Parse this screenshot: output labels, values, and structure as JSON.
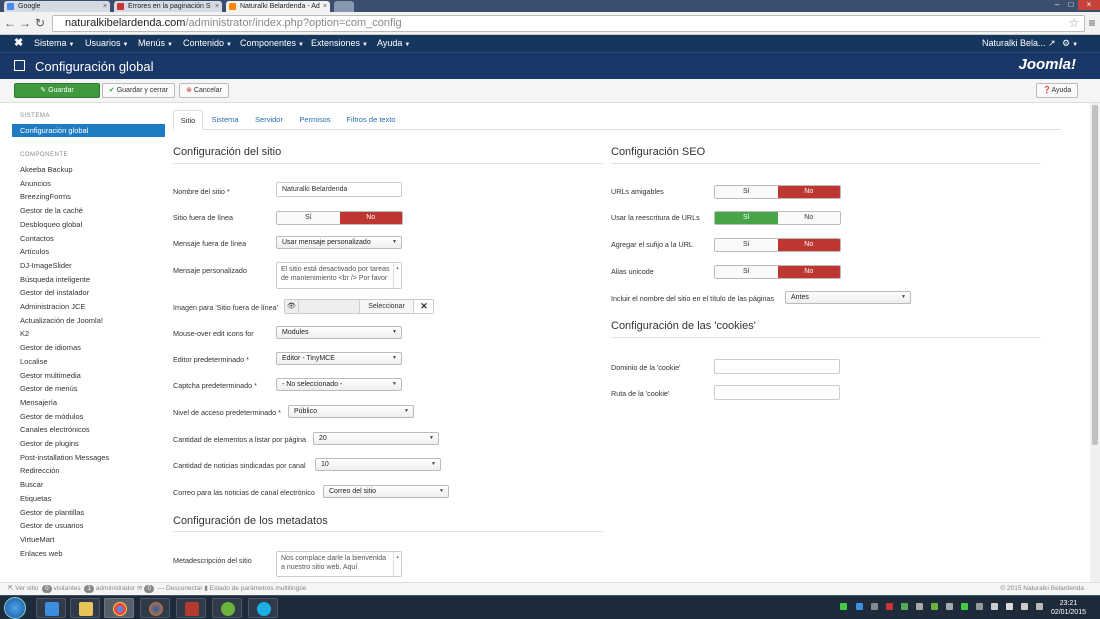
{
  "browser": {
    "tabs": [
      {
        "label": "Google"
      },
      {
        "label": "Errores en la paginación S"
      },
      {
        "label": "Naturalki Belardenda - Ad"
      }
    ],
    "url_host": "naturalkibelardenda.com",
    "url_path": "/administrator/index.php?option=com_config"
  },
  "navbar": {
    "menus": [
      "Sistema",
      "Usuarios",
      "Menús",
      "Contenido",
      "Componentes",
      "Extensiones",
      "Ayuda"
    ],
    "site_name": "Naturalki Bela..."
  },
  "header": {
    "title": "Configuración global",
    "logo": "Joomla!"
  },
  "toolbar": {
    "save": "Guardar",
    "save_close": "Guardar y cerrar",
    "cancel": "Cancelar",
    "help": "Ayuda"
  },
  "sidebar": {
    "system_heading": "SISTEMA",
    "active": "Configuración global",
    "component_heading": "COMPONENTE",
    "items": [
      "Akeeba Backup",
      "Anuncios",
      "BreezingForms",
      "Gestor de la caché",
      "Desbloqueo global",
      "Contactos",
      "Artículos",
      "DJ-ImageSlider",
      "Búsqueda inteligente",
      "Gestor del instalador",
      "Administracion JCE",
      "Actualización de Joomla!",
      "K2",
      "Gestor de idiomas",
      "Localise",
      "Gestor multimedia",
      "Gestor de menús",
      "Mensajería",
      "Gestor de módulos",
      "Canales electrónicos",
      "Gestor de plugins",
      "Post-installation Messages",
      "Redirección",
      "Buscar",
      "Etiquetas",
      "Gestor de plantillas",
      "Gestor de usuarios",
      "VirtueMart",
      "Enlaces web"
    ]
  },
  "tabs": [
    "Sitio",
    "Sistema",
    "Servidor",
    "Permisos",
    "Filtros de texto"
  ],
  "site": {
    "heading": "Configuración del sitio",
    "site_name_label": "Nombre del sitio *",
    "site_name_value": "Naturalki Belardenda",
    "offline_label": "Sitio fuera de línea",
    "offline_msg_label": "Mensaje fuera de línea",
    "offline_msg_value": "Usar mensaje personalizado",
    "custom_msg_label": "Mensaje personalizado",
    "custom_msg_value": "El sitio está desactivado por tareas de mantenimiento <br /> Por favor",
    "offline_image_label": "Imagen para 'Sitio fuera de línea'",
    "select_label": "Seleccionar",
    "mouseover_label": "Mouse-over edit icons for",
    "mouseover_value": "Modules",
    "editor_label": "Editor predeterminado *",
    "editor_value": "Editor - TinyMCE",
    "captcha_label": "Captcha predeterminado *",
    "captcha_value": "- No seleccionado -",
    "access_label": "Nivel de acceso predeterminado *",
    "access_value": "Público",
    "list_label": "Cantidad de elementos a listar por página",
    "list_value": "20",
    "feed_label": "Cantidad de noticias sindicadas por canal",
    "feed_value": "10",
    "feed_email_label": "Correo para las noticias de canal electrónico",
    "feed_email_value": "Correo del sitio"
  },
  "metadata": {
    "heading": "Configuración de los metadatos",
    "desc_label": "Metadescripción del sitio",
    "desc_value": "Nos complace darle la bienvenida a nuestro sitio web. Aquí"
  },
  "seo": {
    "heading": "Configuración SEO",
    "friendly_label": "URLs amigables",
    "rewrite_label": "Usar la reescritura de URLs",
    "suffix_label": "Agregar el sufijo a la URL",
    "unicode_label": "Alias unicode",
    "sitename_label": "Incluir el nombre del sitio en el título de las páginas",
    "sitename_value": "Antes",
    "yes": "Sí",
    "no": "No"
  },
  "cookies": {
    "heading": "Configuración de las 'cookies'",
    "domain_label": "Dominio de la 'cookie'",
    "path_label": "Ruta de la 'cookie'"
  },
  "statusbar": {
    "view_site": "Ver sitio",
    "visitors_count": "0",
    "visitors": "visitantes",
    "admins_count": "1",
    "admins": "administrador",
    "messages_count": "0",
    "logout": "Desconectar",
    "multilang": "Estado de parámetros multilingüe",
    "copyright": "© 2015 Naturalki Belardenda"
  },
  "taskbar": {
    "time": "23:21",
    "date": "02/01/2015"
  },
  "colors": {
    "navbar": "#17365e",
    "header": "#1a3867",
    "active": "#1e7cc4",
    "no_red": "#bd362f",
    "yes_green": "#47a447",
    "save_green": "#3f9a3f"
  }
}
